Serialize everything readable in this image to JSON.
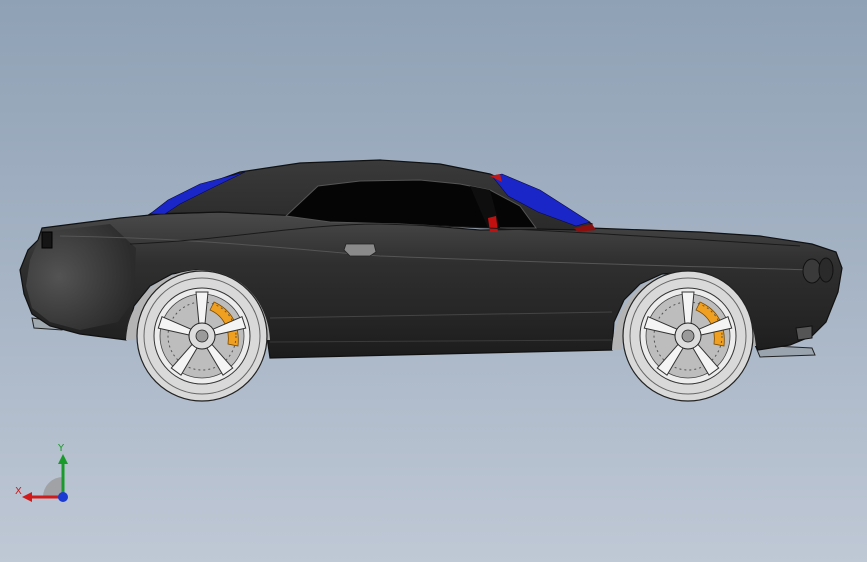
{
  "viewport": {
    "background_top": "#8fa1b5",
    "background_bottom": "#bfc8d5"
  },
  "model": {
    "body_color": "#2c2c2c",
    "stripe_color": "#1a26c8",
    "brake_caliper_color": "#f0a020",
    "tire_color": "#d8d8d8"
  },
  "triad": {
    "x_label": "X",
    "y_label": "Y",
    "x_color": "#d11a1a",
    "y_color": "#1a9a2a",
    "z_color": "#1a3ad1"
  }
}
